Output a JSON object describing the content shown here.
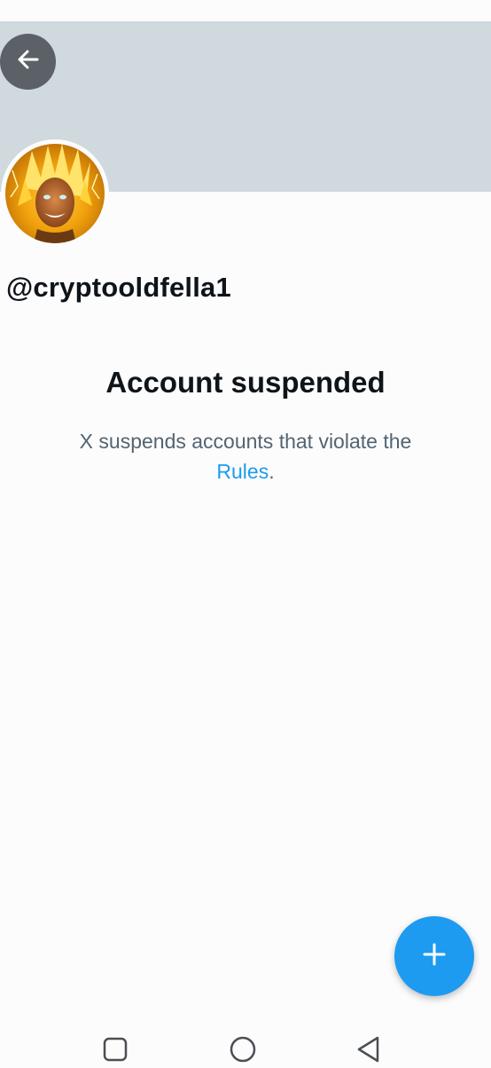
{
  "profile": {
    "handle": "@cryptooldfella1"
  },
  "suspension": {
    "title": "Account suspended",
    "message_prefix": "X suspends accounts that violate the",
    "link_text": "Rules",
    "message_suffix": "."
  },
  "icons": {
    "back": "arrow-left-icon",
    "fab": "plus-icon",
    "nav_recents": "square-icon",
    "nav_home": "circle-icon",
    "nav_back": "triangle-back-icon"
  },
  "colors": {
    "banner": "#cfd9de",
    "accent": "#1d9bf0",
    "text_primary": "#0f1419",
    "text_secondary": "#536471"
  }
}
